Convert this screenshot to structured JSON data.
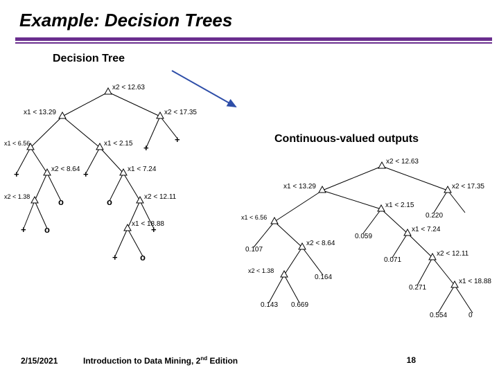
{
  "slide": {
    "title": "Example: Decision Trees",
    "sub_left": "Decision Tree",
    "sub_right": "Continuous-valued outputs",
    "footer_date": "2/15/2021",
    "footer_mid_a": "Introduction to Data Mining, 2",
    "footer_mid_sup": "nd",
    "footer_mid_b": " Edition",
    "footer_page": "18"
  },
  "tree_left": {
    "root": "x2 < 12.63",
    "L": {
      "label": "x1 < 13.29",
      "L": {
        "label": "x1 < 6.56",
        "L": "+",
        "R": {
          "label": "x2 < 8.64",
          "L": {
            "label": "x2 < 1.38",
            "L": "+",
            "R": "o"
          },
          "R": "o"
        }
      },
      "R": {
        "label": "x1 < 2.15",
        "L": "+",
        "R": {
          "label": "x1 < 7.24",
          "L": {
            "label": "x2 < 12.11",
            "L": {
              "label": "x1 < 18.88",
              "L": "+",
              "R": "o"
            },
            "R": "+"
          },
          "R": "o"
        }
      }
    },
    "R": {
      "label": "x2 < 17.35",
      "L": "+",
      "R": "+"
    }
  },
  "tree_right": {
    "root": "x2 < 12.63",
    "L": {
      "label": "x1 < 13.29",
      "L": {
        "label": "x1 < 6.56",
        "L": "0.107",
        "R": {
          "label": "x2 < 8.64",
          "L": {
            "label": "x2 < 1.38",
            "L": "0.143",
            "R": "0.669"
          },
          "R": "0.164"
        }
      },
      "R": {
        "label": "x1 < 2.15",
        "L": "0.059",
        "R": {
          "label": "x1 < 7.24",
          "L": "0.071",
          "R": {
            "label": "x2 < 12.11",
            "L": "0.271",
            "R": {
              "label": "x1 < 18.88",
              "L": "0.554",
              "R": "0"
            }
          }
        }
      }
    },
    "R": {
      "label": "x2 < 17.35",
      "L": "0.220",
      "R": ""
    }
  }
}
